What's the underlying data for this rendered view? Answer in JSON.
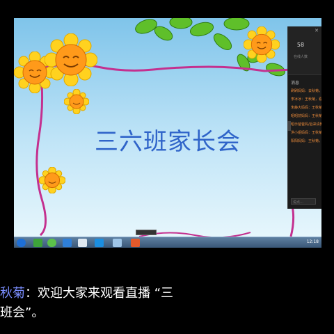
{
  "slide": {
    "title": "三六班家长会"
  },
  "live_panel": {
    "viewer_count": "58",
    "viewer_label": "在线人数",
    "messages_header": "消息",
    "messages": [
      "刷刷妈妈：去秋菊，加油",
      "李冰冰：王秋菊，看来没有",
      "朱静大妈妈：王秋菊，你好",
      "昭昭前妈妈：王秋菊，已",
      "昭示爸爸妈/后来请教你",
      "洪小姐妈妈：王秋菊，你",
      "阳阳妈妈：王秋菊，你好"
    ],
    "input_placeholder": "说点…"
  },
  "taskbar": {
    "clock": "12:18",
    "icons": [
      "ie-icon",
      "browser-icon",
      "refresh-icon",
      "security-icon",
      "chat-icon",
      "app-icon",
      "photo-icon",
      "powerpoint-icon"
    ]
  },
  "caption": {
    "speaker": "秋菊",
    "separator": "：",
    "line1_text": "欢迎大家来观看直播 “三",
    "line2_text": "班会”。"
  },
  "colors": {
    "title": "#2f64c9",
    "speaker": "#7a8eff",
    "frame": "#c4308f",
    "sun_petal": "#ffd21f",
    "sun_face": "#ff9a1a",
    "leaf": "#4ca81f"
  }
}
